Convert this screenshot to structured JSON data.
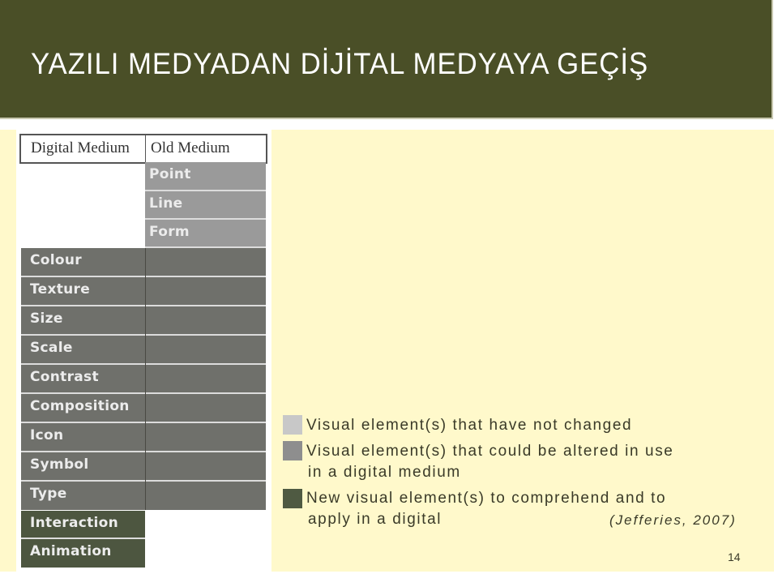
{
  "slide": {
    "title": "YAZILI MEDYADAN DİJİTAL MEDYAYA GEÇİŞ",
    "page_number": "14",
    "colors": {
      "header_bg": "#4a4f27",
      "panel_bg": "#fff9cb",
      "unchanged": "#9a9a9a",
      "altered": "#6f706b",
      "new": "#4d5640"
    }
  },
  "table": {
    "headers": [
      "Digital Medium",
      "Old Medium"
    ],
    "old_only_rows": [
      "Point",
      "Line",
      "Form"
    ],
    "shared_rows": [
      "Colour",
      "Texture",
      "Size",
      "Scale",
      "Contrast",
      "Composition",
      "Icon",
      "Symbol",
      "Type"
    ],
    "digital_only_rows": [
      "Interaction",
      "Animation"
    ]
  },
  "legend": {
    "items": [
      {
        "swatch_color": "#c8c8c8",
        "lines": [
          "Visual element(s) that have  not changed"
        ]
      },
      {
        "swatch_color": "#8e8e8e",
        "lines": [
          "Visual element(s) that could be altered in use",
          "in a digital medium"
        ]
      },
      {
        "swatch_color": "#4f5a42",
        "lines": [
          "New visual element(s) to comprehend and to",
          "apply in a digital"
        ]
      }
    ],
    "citation": "(Jefferies, 2007)"
  }
}
